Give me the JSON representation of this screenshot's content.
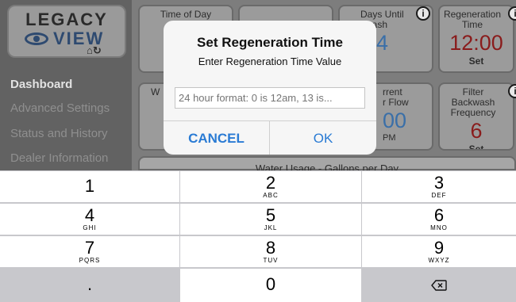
{
  "sidebar": {
    "logo_line1": "LEGACY",
    "logo_line2": "VIEW",
    "logo_icons": "⌂↻",
    "items": [
      {
        "label": "Dashboard"
      },
      {
        "label": "Advanced Settings"
      },
      {
        "label": "Status and History"
      },
      {
        "label": "Dealer Information"
      }
    ]
  },
  "tiles": {
    "time_of_day": {
      "title": "Time of Day"
    },
    "days_until_backwash": {
      "title_a": "Days Until",
      "title_b": "kwash",
      "value": "4"
    },
    "regeneration_time": {
      "title_a": "Regeneration",
      "title_b": "Time",
      "value": "12:00",
      "action": "Set"
    },
    "water_tile": {
      "title": "W"
    },
    "current_flow": {
      "title_a": "rrent",
      "title_b": "r Flow",
      "value": "00",
      "unit": "PM"
    },
    "filter_backwash": {
      "title_a": "Filter Backwash",
      "title_b": "Frequency",
      "value": "6",
      "action": "Set"
    },
    "usage_title": "Water Usage - Gallons per Day"
  },
  "dialog": {
    "title": "Set Regeneration Time",
    "message": "Enter Regeneration Time Value",
    "input_placeholder": "24 hour format: 0 is 12am, 13 is...",
    "input_value": "",
    "cancel_label": "CANCEL",
    "ok_label": "OK"
  },
  "keyboard": {
    "rows": [
      [
        {
          "digit": "1",
          "letters": ""
        },
        {
          "digit": "2",
          "letters": "ABC"
        },
        {
          "digit": "3",
          "letters": "DEF"
        }
      ],
      [
        {
          "digit": "4",
          "letters": "GHI"
        },
        {
          "digit": "5",
          "letters": "JKL"
        },
        {
          "digit": "6",
          "letters": "MNO"
        }
      ],
      [
        {
          "digit": "7",
          "letters": "PQRS"
        },
        {
          "digit": "8",
          "letters": "TUV"
        },
        {
          "digit": "9",
          "letters": "WXYZ"
        }
      ]
    ],
    "bottom": {
      "decimal": ".",
      "zero": "0",
      "delete_icon": "backspace-icon"
    }
  },
  "colors": {
    "accent": "#2a7bd4",
    "regen_value": "#8a1c1c",
    "flow_value": "#3a6fa8"
  }
}
